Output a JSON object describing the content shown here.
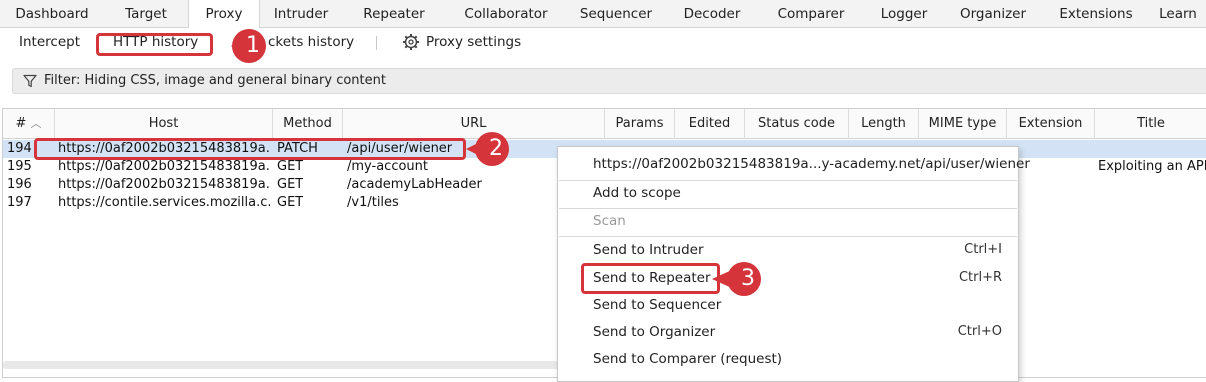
{
  "top_tabs": [
    "Dashboard",
    "Target",
    "Proxy",
    "Intruder",
    "Repeater",
    "Collaborator",
    "Sequencer",
    "Decoder",
    "Comparer",
    "Logger",
    "Organizer",
    "Extensions",
    "Learn"
  ],
  "sub_tabs": {
    "intercept": "Intercept",
    "http_history": "HTTP history",
    "websockets_history": "ckets history",
    "proxy_settings": "Proxy settings"
  },
  "filter": {
    "text": "Filter: Hiding CSS, image and general binary content"
  },
  "columns": {
    "num": "#",
    "host": "Host",
    "method": "Method",
    "url": "URL",
    "params": "Params",
    "edited": "Edited",
    "status": "Status code",
    "length": "Length",
    "mime": "MIME type",
    "extension": "Extension",
    "title": "Title"
  },
  "rows": [
    {
      "num": "194",
      "host": "https://0af2002b03215483819a...",
      "method": "PATCH",
      "url": "/api/user/wiener",
      "title": ""
    },
    {
      "num": "195",
      "host": "https://0af2002b03215483819a...",
      "method": "GET",
      "url": "/my-account",
      "title": "Exploiting an API e"
    },
    {
      "num": "196",
      "host": "https://0af2002b03215483819a...",
      "method": "GET",
      "url": "/academyLabHeader",
      "title": ""
    },
    {
      "num": "197",
      "host": "https://contile.services.mozilla.c...",
      "method": "GET",
      "url": "/v1/tiles",
      "title": ""
    }
  ],
  "context_menu": {
    "url": "https://0af2002b03215483819a...y-academy.net/api/user/wiener",
    "add_to_scope": "Add to scope",
    "scan": "Scan",
    "send_to_intruder": "Send to Intruder",
    "send_to_intruder_shortcut": "Ctrl+I",
    "send_to_repeater": "Send to Repeater",
    "send_to_repeater_shortcut": "Ctrl+R",
    "send_to_sequencer": "Send to Sequencer",
    "send_to_organizer": "Send to Organizer",
    "send_to_organizer_shortcut": "Ctrl+O",
    "send_to_comparer": "Send to Comparer (request)"
  },
  "callouts": {
    "one": "1",
    "two": "2",
    "three": "3"
  },
  "colors": {
    "accent_red": "#d4343a",
    "selected_row": "#d3e3f5",
    "tab_bar": "#f3f3f3"
  }
}
